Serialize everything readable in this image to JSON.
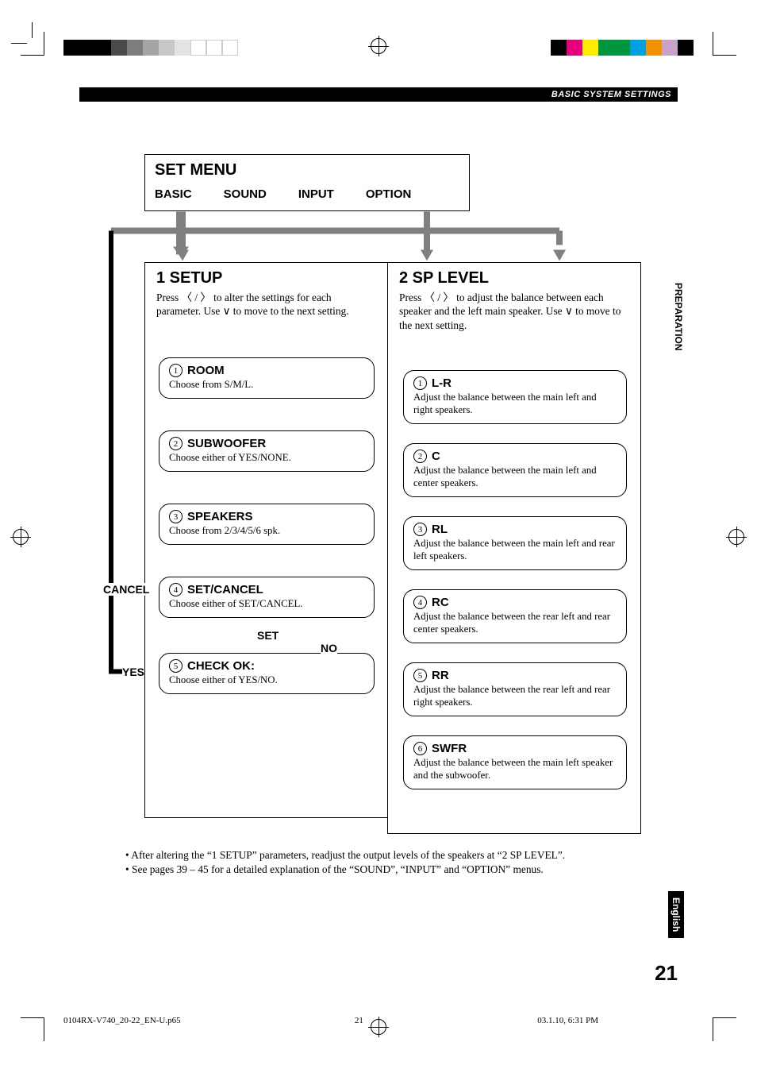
{
  "header": {
    "section": "BASIC SYSTEM SETTINGS"
  },
  "side_tabs": {
    "preparation": "PREPARATION",
    "english": "English"
  },
  "page_number": "21",
  "footer": {
    "file": "0104RX-V740_20-22_EN-U.p65",
    "page": "21",
    "stamp": "03.1.10, 6:31 PM"
  },
  "set_menu": {
    "title": "SET MENU",
    "tabs": [
      "BASIC",
      "SOUND",
      "INPUT",
      "OPTION"
    ]
  },
  "columns": {
    "setup": {
      "title": "1   SETUP",
      "desc": "Press 〈 / 〉 to alter the settings for each parameter. Use ∨ to move to the next setting.",
      "steps": [
        {
          "num": "1",
          "title": "ROOM",
          "desc": "Choose from S/M/L."
        },
        {
          "num": "2",
          "title": "SUBWOOFER",
          "desc": "Choose either of YES/NONE."
        },
        {
          "num": "3",
          "title": "SPEAKERS",
          "desc": "Choose from 2/3/4/5/6 spk."
        },
        {
          "num": "4",
          "title": "SET/CANCEL",
          "desc": "Choose either of SET/CANCEL."
        },
        {
          "num": "5",
          "title": "CHECK OK:",
          "desc": "Choose either of YES/NO."
        }
      ]
    },
    "sp_level": {
      "title": "2   SP LEVEL",
      "desc": "Press 〈 / 〉 to adjust the balance between each speaker and the left main speaker. Use ∨ to move to the next setting.",
      "steps": [
        {
          "num": "1",
          "title": "L-R",
          "desc": "Adjust the balance between the main left and right speakers."
        },
        {
          "num": "2",
          "title": "C",
          "desc": "Adjust the balance between the main left and center speakers."
        },
        {
          "num": "3",
          "title": "RL",
          "desc": "Adjust the balance between the main left and rear left speakers."
        },
        {
          "num": "4",
          "title": "RC",
          "desc": "Adjust the balance between the rear left and rear center speakers."
        },
        {
          "num": "5",
          "title": "RR",
          "desc": "Adjust the balance between the rear left and rear right speakers."
        },
        {
          "num": "6",
          "title": "SWFR",
          "desc": "Adjust the balance between the main left speaker and the subwoofer."
        }
      ]
    }
  },
  "flow_labels": {
    "cancel": "CANCEL",
    "set": "SET",
    "no": "NO",
    "yes": "YES"
  },
  "notes": [
    "After altering the “1 SETUP” parameters, readjust the output levels of the speakers at “2 SP LEVEL”.",
    "See pages 39 – 45 for a detailed explanation of the “SOUND”, “INPUT” and “OPTION” menus."
  ],
  "colors": {
    "color_bar_left": [
      "#000",
      "#4a4a4a",
      "#7d7d7d",
      "#a5a5a5",
      "#c8c8c8",
      "#e3e3e3",
      "#fff"
    ],
    "color_bar_right": [
      "#000",
      "#e6007e",
      "#ffed00",
      "#009640",
      "#00a0e3",
      "#f39200",
      "#c8a2c8",
      "#000"
    ]
  },
  "chart_data": {
    "type": "diagram",
    "title": "SET MENU flow",
    "description": "Hierarchical menu flow. SET MENU has tabs BASIC, SOUND, INPUT, OPTION. BASIC tab leads to 1 SETUP and 2 SP LEVEL. 1 SETUP steps flow ROOM → SUBWOOFER → SPEAKERS → SET/CANCEL → (SET) → CHECK OK:. From SET/CANCEL, CANCEL loops back to top of 1 SETUP. From CHECK OK:, YES loops back to top of 1 SETUP, NO branches to 2 SP LEVEL. 2 SP LEVEL steps flow L-R → C → RL → RC → RR → SWFR. OPTION tab arrow also points to 2 SP LEVEL column."
  }
}
